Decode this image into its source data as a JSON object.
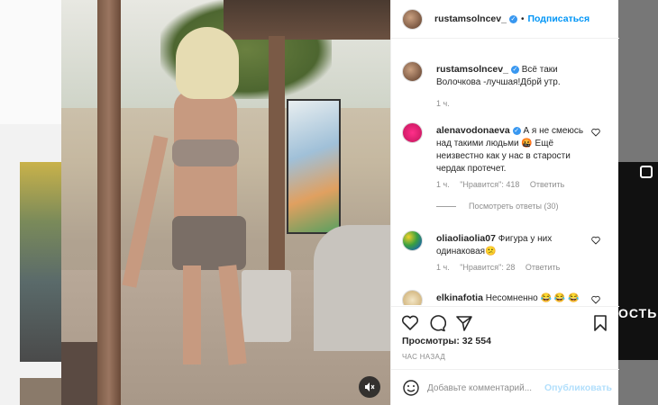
{
  "header": {
    "username": "rustamsolncev_",
    "separator": "•",
    "follow_label": "Подписаться"
  },
  "caption": {
    "username": "rustamsolncev_",
    "text": "Всё таки Волочкова -лучшая!Дбрй утр.",
    "time": "1 ч."
  },
  "comments": [
    {
      "username": "alenavodonaeva",
      "verified": true,
      "text": "А я не смеюсь над такими людьми 🤬 Ещё неизвестно как у нас в старости чердак протечет.",
      "time": "1 ч.",
      "likes": "\"Нравится\": 418",
      "reply": "Ответить",
      "more": "Посмотреть ответы (30)"
    },
    {
      "username": "oliaoliaolia07",
      "verified": false,
      "text": "Фигура у них одинаковая😕",
      "time": "1 ч.",
      "likes": "\"Нравится\": 28",
      "reply": "Ответить"
    },
    {
      "username": "elkinafotia",
      "verified": false,
      "text": "Несомненно 😂 😂 😂",
      "time": "",
      "likes": "",
      "reply": ""
    }
  ],
  "stats": {
    "views": "Просмотры: 32 554",
    "time_ago": "ЧАС НАЗАД"
  },
  "add_comment": {
    "placeholder": "Добавьте комментарий...",
    "post_label": "Опубликовать"
  },
  "right_thumb_text": "ОСТЬ",
  "colors": {
    "link_blue": "#0095f6",
    "post_disabled": "#b2dffc",
    "verified": "#3897f0"
  }
}
